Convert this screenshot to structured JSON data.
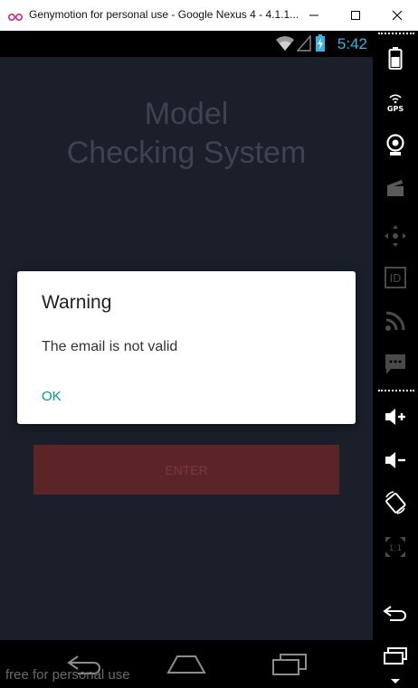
{
  "window": {
    "title": "Genymotion for personal use - Google Nexus 4 - 4.1.1...",
    "controls": [
      "minimize",
      "maximize",
      "close"
    ]
  },
  "statusbar": {
    "time": "5:42",
    "icons": [
      "wifi-icon",
      "signal-icon",
      "battery-icon"
    ]
  },
  "app": {
    "title_line1": "Model",
    "title_line2": "Checking System",
    "enter_label": "ENTER"
  },
  "dialog": {
    "title": "Warning",
    "message": "The email is not valid",
    "ok_label": "OK"
  },
  "navbar": {
    "watermark": "free for personal use",
    "buttons": [
      "back-icon",
      "home-icon",
      "recents-icon"
    ]
  },
  "sidebar": {
    "gps_label": "GPS",
    "id_label": "ID",
    "scale_label": "1:1",
    "items": [
      "battery-icon",
      "gps-icon",
      "camera-icon",
      "clapper-icon",
      "dpad-icon",
      "id-icon",
      "rss-icon",
      "sms-icon",
      "volume-up-icon",
      "volume-down-icon",
      "rotate-icon",
      "scale-icon",
      "back-icon",
      "recents-icon"
    ]
  },
  "colors": {
    "accent_blue": "#33b5e5",
    "ok_teal": "#009688",
    "enter_button": "#5b2427",
    "screen_bg": "#1a1f2a"
  }
}
